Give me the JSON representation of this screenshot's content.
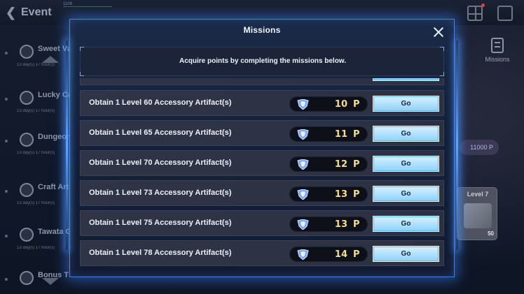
{
  "background": {
    "event_title": "Event",
    "uid_text": "1108",
    "sidebar_items": [
      {
        "label": "Sweet Valentine",
        "time": "13 day(s) 17 hour(s)"
      },
      {
        "label": "Lucky Ca",
        "time": "13 day(s) 17 hour(s)"
      },
      {
        "label": "Dungeon Exploration Challenge",
        "time": "13 day(s) 17 hour(s)"
      },
      {
        "label": "Craft Art",
        "time": "13 day(s) 17 hour(s)"
      },
      {
        "label": "Tawata Growth",
        "time": "13 day(s) 17 hour(s)"
      },
      {
        "label": "Bonus T",
        "time": ""
      }
    ],
    "missions_label": "Missions",
    "points_pill": "11000 P",
    "level_card": {
      "label": "Level 7",
      "count": "50"
    }
  },
  "dialog": {
    "title": "Missions",
    "info": "Acquire points by completing the missions below.",
    "missions": [
      {
        "label": "",
        "points": "",
        "unit": "",
        "go": ""
      },
      {
        "label": "Obtain 1 Level 60 Accessory Artifact(s)",
        "points": "10",
        "unit": "P",
        "go": "Go"
      },
      {
        "label": "Obtain 1 Level 65 Accessory Artifact(s)",
        "points": "11",
        "unit": "P",
        "go": "Go"
      },
      {
        "label": "Obtain 1 Level 70 Accessory Artifact(s)",
        "points": "12",
        "unit": "P",
        "go": "Go"
      },
      {
        "label": "Obtain 1 Level 73 Accessory Artifact(s)",
        "points": "13",
        "unit": "P",
        "go": "Go"
      },
      {
        "label": "Obtain 1 Level 75 Accessory Artifact(s)",
        "points": "13",
        "unit": "P",
        "go": "Go"
      },
      {
        "label": "Obtain 1 Level 78 Accessory Artifact(s)",
        "points": "14",
        "unit": "P",
        "go": "Go"
      }
    ]
  },
  "colors": {
    "go_button": "#aee0ff",
    "points_text": "#f6dc8b",
    "dialog_border": "#4d7fd9"
  }
}
